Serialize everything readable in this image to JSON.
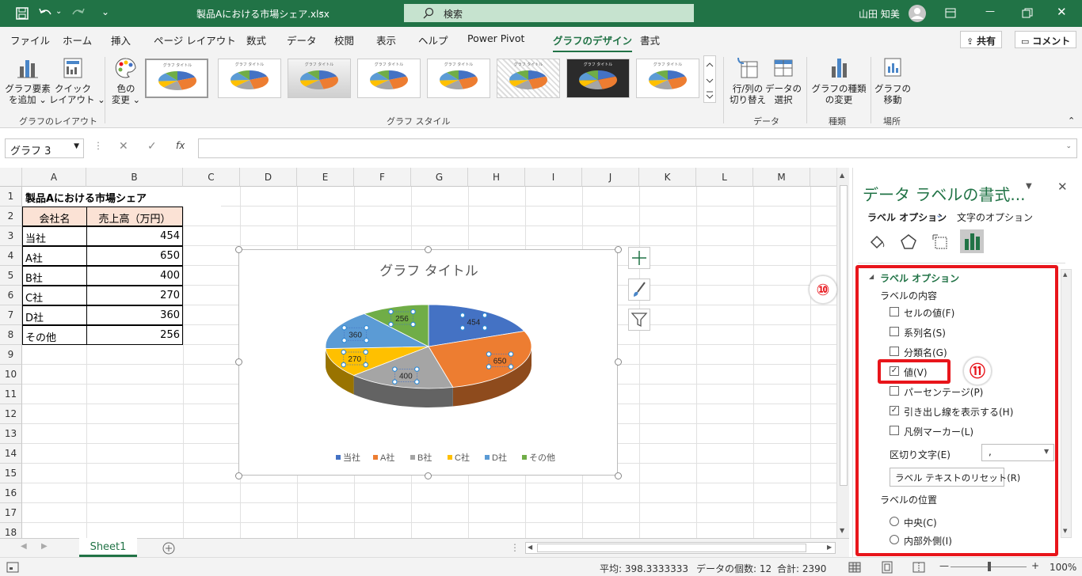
{
  "window": {
    "filename": "製品Aにおける市場シェア.xlsx",
    "search_label": "検索",
    "user_name": "山田 知美"
  },
  "tabs": [
    "ファイル",
    "ホーム",
    "挿入",
    "ページ レイアウト",
    "数式",
    "データ",
    "校閲",
    "表示",
    "ヘルプ",
    "Power Pivot",
    "グラフのデザイン",
    "書式"
  ],
  "share_label": "共有",
  "comment_label": "コメント",
  "ribbon": {
    "add_element": [
      "グラフ要素",
      "を追加 ⌄"
    ],
    "quick_layout": [
      "クイック",
      "レイアウト ⌄"
    ],
    "layout_group": "グラフのレイアウト",
    "color_change": [
      "色の",
      "変更 ⌄"
    ],
    "styles_group": "グラフ スタイル",
    "style_thumb_title": "グラフ タイトル",
    "switch_rowcol": [
      "行/列の",
      "切り替え"
    ],
    "select_data": [
      "データの",
      "選択"
    ],
    "data_group": "データ",
    "change_type": [
      "グラフの種類",
      "の変更"
    ],
    "type_group": "種類",
    "move_chart": [
      "グラフの",
      "移動"
    ],
    "location_group": "場所"
  },
  "namebox": "グラフ 3",
  "fx": "fx",
  "columns": [
    "A",
    "B",
    "C",
    "D",
    "E",
    "F",
    "G",
    "H",
    "I",
    "J",
    "K",
    "L",
    "M"
  ],
  "rows": [
    "1",
    "2",
    "3",
    "4",
    "5",
    "6",
    "7",
    "8",
    "9",
    "10",
    "11",
    "12",
    "13",
    "14",
    "15",
    "16",
    "17",
    "18"
  ],
  "sheet": {
    "title": "製品Aにおける市場シェア",
    "headers": [
      "会社名",
      "売上高（万円）"
    ],
    "data": [
      [
        "当社",
        "454"
      ],
      [
        "A社",
        "650"
      ],
      [
        "B社",
        "400"
      ],
      [
        "C社",
        "270"
      ],
      [
        "D社",
        "360"
      ],
      [
        "その他",
        "256"
      ]
    ]
  },
  "chart_data": {
    "type": "pie",
    "title": "グラフ タイトル",
    "categories": [
      "当社",
      "A社",
      "B社",
      "C社",
      "D社",
      "その他"
    ],
    "values": [
      454,
      650,
      400,
      270,
      360,
      256
    ],
    "colors": [
      "#4472c4",
      "#ed7d31",
      "#a5a5a5",
      "#ffc000",
      "#5b9bd5",
      "#70ad47"
    ],
    "data_labels": [
      "454",
      "650",
      "400",
      "270",
      "360",
      "256"
    ],
    "legend_position": "bottom"
  },
  "sheet_tab": "Sheet1",
  "status": {
    "average": "平均: 398.3333333",
    "count": "データの個数: 12",
    "sum": "合計: 2390",
    "zoom": "100%"
  },
  "pane": {
    "title": "データ ラベルの書式...",
    "tab_label_options": "ラベル オプション",
    "tab_text_options": "文字のオプション",
    "section": "ラベル オプション",
    "contents_heading": "ラベルの内容",
    "options": [
      {
        "label": "セルの値(F)",
        "checked": false
      },
      {
        "label": "系列名(S)",
        "checked": false
      },
      {
        "label": "分類名(G)",
        "checked": false
      },
      {
        "label": "値(V)",
        "checked": true
      },
      {
        "label": "パーセンテージ(P)",
        "checked": false
      },
      {
        "label": "引き出し線を表示する(H)",
        "checked": true
      },
      {
        "label": "凡例マーカー(L)",
        "checked": false
      }
    ],
    "separator_label": "区切り文字(E)",
    "separator_value": ",",
    "reset_button": "ラベル テキストのリセット(R)",
    "position_heading": "ラベルの位置",
    "position_center": "中央(C)",
    "position_inside_end": "内部外側(I)"
  },
  "annotations": {
    "badge10": "⑩",
    "badge11": "⑪"
  },
  "accent_color": "#217346",
  "highlight_color": "#e8151b"
}
